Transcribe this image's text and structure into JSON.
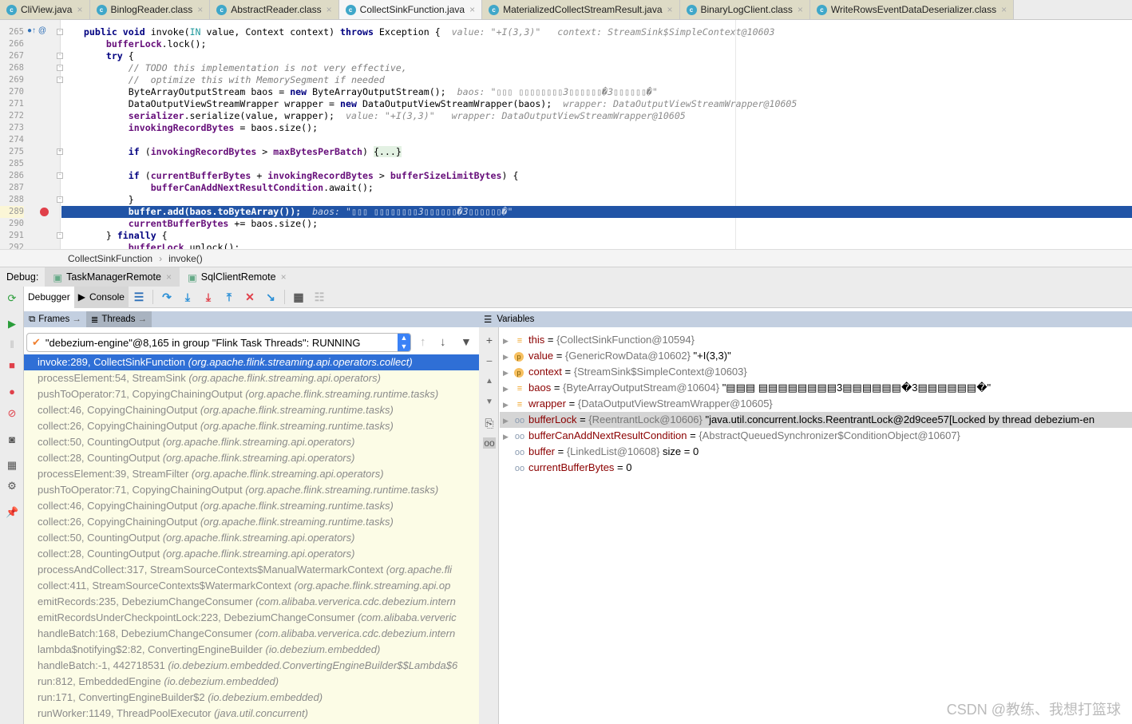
{
  "tabs": [
    {
      "label": "CliView.java",
      "active": false
    },
    {
      "label": "BinlogReader.class",
      "active": false
    },
    {
      "label": "AbstractReader.class",
      "active": false
    },
    {
      "label": "CollectSinkFunction.java",
      "active": true
    },
    {
      "label": "MaterializedCollectStreamResult.java",
      "active": false
    },
    {
      "label": "BinaryLogClient.class",
      "active": false
    },
    {
      "label": "WriteRowsEventDataDeserializer.class",
      "active": false
    }
  ],
  "editor": {
    "current_line": "289",
    "lines": [
      {
        "n": "265",
        "fold": "-",
        "segs": [
          [
            "    "
          ],
          [
            "public void ",
            "kw"
          ],
          [
            "invoke("
          ],
          [
            "IN",
            "ty"
          ],
          [
            " value, Context context) "
          ],
          [
            "throws",
            "kw"
          ],
          [
            " Exception {  "
          ],
          [
            "value: \"+I(3,3)\"   context: StreamSink$SimpleContext@10603",
            "hint"
          ]
        ]
      },
      {
        "n": "266",
        "segs": [
          [
            "        "
          ],
          [
            "bufferLock",
            "fld"
          ],
          [
            ".lock();"
          ]
        ]
      },
      {
        "n": "267",
        "fold": "-",
        "segs": [
          [
            "        "
          ],
          [
            "try",
            "kw"
          ],
          [
            " {"
          ]
        ]
      },
      {
        "n": "268",
        "fold": "-",
        "segs": [
          [
            "            "
          ],
          [
            "// TODO this implementation is not very effective,",
            "cm"
          ]
        ]
      },
      {
        "n": "269",
        "fold": "-",
        "segs": [
          [
            "            "
          ],
          [
            "//  optimize this with MemorySegment if needed",
            "cm"
          ]
        ]
      },
      {
        "n": "270",
        "segs": [
          [
            "            ByteArrayOutputStream baos = "
          ],
          [
            "new",
            "kw"
          ],
          [
            " ByteArrayOutputStream();  "
          ],
          [
            "baos: \"▯▯▯ ▯▯▯▯▯▯▯▯3▯▯▯▯▯▯�3▯▯▯▯▯▯�\"",
            "hint"
          ]
        ]
      },
      {
        "n": "271",
        "segs": [
          [
            "            DataOutputViewStreamWrapper wrapper = "
          ],
          [
            "new",
            "kw"
          ],
          [
            " DataOutputViewStreamWrapper(baos);  "
          ],
          [
            "wrapper: DataOutputViewStreamWrapper@10605",
            "hint"
          ]
        ]
      },
      {
        "n": "272",
        "segs": [
          [
            "            "
          ],
          [
            "serializer",
            "fld"
          ],
          [
            ".serialize(value, wrapper);  "
          ],
          [
            "value: \"+I(3,3)\"   wrapper: DataOutputViewStreamWrapper@10605",
            "hint"
          ]
        ]
      },
      {
        "n": "273",
        "segs": [
          [
            "            "
          ],
          [
            "invokingRecordBytes",
            "fld"
          ],
          [
            " = baos.size();"
          ]
        ]
      },
      {
        "n": "274",
        "segs": [
          [
            ""
          ]
        ]
      },
      {
        "n": "275",
        "fold": "+",
        "segs": [
          [
            "            "
          ],
          [
            "if",
            "kw"
          ],
          [
            " ("
          ],
          [
            "invokingRecordBytes",
            "fld"
          ],
          [
            " > "
          ],
          [
            "maxBytesPerBatch",
            "fld"
          ],
          [
            ") "
          ],
          [
            "{...}",
            "foldbox"
          ]
        ]
      },
      {
        "n": "285",
        "segs": [
          [
            ""
          ]
        ]
      },
      {
        "n": "286",
        "fold": "-",
        "segs": [
          [
            "            "
          ],
          [
            "if",
            "kw"
          ],
          [
            " ("
          ],
          [
            "currentBufferBytes",
            "fld"
          ],
          [
            " + "
          ],
          [
            "invokingRecordBytes",
            "fld"
          ],
          [
            " > "
          ],
          [
            "bufferSizeLimitBytes",
            "fld"
          ],
          [
            ") {"
          ]
        ]
      },
      {
        "n": "287",
        "segs": [
          [
            "                "
          ],
          [
            "bufferCanAddNextResultCondition",
            "fld"
          ],
          [
            ".await();"
          ]
        ]
      },
      {
        "n": "288",
        "fold": "-",
        "segs": [
          [
            "            }"
          ]
        ]
      },
      {
        "n": "289",
        "hl": true,
        "segs": [
          [
            "            "
          ],
          [
            "buffer",
            "fld"
          ],
          [
            ".add(baos.toByteArray());",
            "kw"
          ],
          [
            "  "
          ],
          [
            "baos: \"▯▯▯ ▯▯▯▯▯▯▯▯3▯▯▯▯▯▯�3▯▯▯▯▯▯�\"",
            "hint"
          ]
        ]
      },
      {
        "n": "290",
        "segs": [
          [
            "            "
          ],
          [
            "currentBufferBytes",
            "fld"
          ],
          [
            " += baos.size();"
          ]
        ]
      },
      {
        "n": "291",
        "fold": "-",
        "segs": [
          [
            "        } "
          ],
          [
            "finally",
            "kw"
          ],
          [
            " {"
          ]
        ]
      },
      {
        "n": "292",
        "segs": [
          [
            "            "
          ],
          [
            "bufferLock",
            "fld"
          ],
          [
            ".unlock();"
          ]
        ]
      }
    ]
  },
  "breadcrumb": {
    "class": "CollectSinkFunction",
    "method": "invoke()",
    "sep": "›"
  },
  "debug": {
    "label": "Debug:",
    "sessions": [
      {
        "label": "TaskManagerRemote",
        "active": true
      },
      {
        "label": "SqlClientRemote",
        "active": false
      }
    ]
  },
  "toolbar": {
    "debugger": "Debugger",
    "console": "Console"
  },
  "frames": {
    "tab_frames": "Frames",
    "tab_threads": "Threads",
    "thread": "\"debezium-engine\"@8,165 in group \"Flink Task Threads\": RUNNING",
    "items": [
      {
        "m": "invoke:289, CollectSinkFunction",
        "p": "(org.apache.flink.streaming.api.operators.collect)",
        "sel": true
      },
      {
        "m": "processElement:54, StreamSink",
        "p": "(org.apache.flink.streaming.api.operators)"
      },
      {
        "m": "pushToOperator:71, CopyingChainingOutput",
        "p": "(org.apache.flink.streaming.runtime.tasks)"
      },
      {
        "m": "collect:46, CopyingChainingOutput",
        "p": "(org.apache.flink.streaming.runtime.tasks)"
      },
      {
        "m": "collect:26, CopyingChainingOutput",
        "p": "(org.apache.flink.streaming.runtime.tasks)"
      },
      {
        "m": "collect:50, CountingOutput",
        "p": "(org.apache.flink.streaming.api.operators)"
      },
      {
        "m": "collect:28, CountingOutput",
        "p": "(org.apache.flink.streaming.api.operators)"
      },
      {
        "m": "processElement:39, StreamFilter",
        "p": "(org.apache.flink.streaming.api.operators)"
      },
      {
        "m": "pushToOperator:71, CopyingChainingOutput",
        "p": "(org.apache.flink.streaming.runtime.tasks)"
      },
      {
        "m": "collect:46, CopyingChainingOutput",
        "p": "(org.apache.flink.streaming.runtime.tasks)"
      },
      {
        "m": "collect:26, CopyingChainingOutput",
        "p": "(org.apache.flink.streaming.runtime.tasks)"
      },
      {
        "m": "collect:50, CountingOutput",
        "p": "(org.apache.flink.streaming.api.operators)"
      },
      {
        "m": "collect:28, CountingOutput",
        "p": "(org.apache.flink.streaming.api.operators)"
      },
      {
        "m": "processAndCollect:317, StreamSourceContexts$ManualWatermarkContext",
        "p": "(org.apache.fli"
      },
      {
        "m": "collect:411, StreamSourceContexts$WatermarkContext",
        "p": "(org.apache.flink.streaming.api.op"
      },
      {
        "m": "emitRecords:235, DebeziumChangeConsumer",
        "p": "(com.alibaba.ververica.cdc.debezium.intern"
      },
      {
        "m": "emitRecordsUnderCheckpointLock:223, DebeziumChangeConsumer",
        "p": "(com.alibaba.ververic"
      },
      {
        "m": "handleBatch:168, DebeziumChangeConsumer",
        "p": "(com.alibaba.ververica.cdc.debezium.intern"
      },
      {
        "m": "lambda$notifying$2:82, ConvertingEngineBuilder",
        "p": "(io.debezium.embedded)"
      },
      {
        "m": "handleBatch:-1, 442718531",
        "p": "(io.debezium.embedded.ConvertingEngineBuilder$$Lambda$6"
      },
      {
        "m": "run:812, EmbeddedEngine",
        "p": "(io.debezium.embedded)"
      },
      {
        "m": "run:171, ConvertingEngineBuilder$2",
        "p": "(io.debezium.embedded)"
      },
      {
        "m": "runWorker:1149, ThreadPoolExecutor",
        "p": "(java.util.concurrent)"
      }
    ]
  },
  "variables": {
    "title": "Variables",
    "items": [
      {
        "icon": "field",
        "expand": true,
        "name": "this",
        "type": "{CollectSinkFunction@10594}",
        "val": ""
      },
      {
        "icon": "param",
        "expand": true,
        "name": "value",
        "type": "{GenericRowData@10602}",
        "val": "\"+I(3,3)\""
      },
      {
        "icon": "param",
        "expand": true,
        "name": "context",
        "type": "{StreamSink$SimpleContext@10603}",
        "val": ""
      },
      {
        "icon": "field",
        "expand": true,
        "name": "baos",
        "type": "{ByteArrayOutputStream@10604}",
        "val": "\"▤▤▤ ▤▤▤▤▤▤▤▤3▤▤▤▤▤▤�3▤▤▤▤▤▤�\""
      },
      {
        "icon": "field",
        "expand": true,
        "name": "wrapper",
        "type": "{DataOutputViewStreamWrapper@10605}",
        "val": ""
      },
      {
        "icon": "watch",
        "expand": true,
        "sel": true,
        "name": "bufferLock",
        "type": "{ReentrantLock@10606}",
        "val": "\"java.util.concurrent.locks.ReentrantLock@2d9cee57[Locked by thread debezium-en"
      },
      {
        "icon": "watch",
        "expand": true,
        "name": "bufferCanAddNextResultCondition",
        "type": "{AbstractQueuedSynchronizer$ConditionObject@10607}",
        "val": ""
      },
      {
        "icon": "watch",
        "expand": false,
        "name": "buffer",
        "type": "{LinkedList@10608}",
        "val": " size = 0"
      },
      {
        "icon": "watch",
        "expand": false,
        "name": "currentBufferBytes",
        "type": "",
        "val": "0"
      }
    ]
  },
  "watermark": "CSDN @教练、我想打篮球",
  "colors": {
    "selection": "#2f6fd6",
    "current_line": "#2154a6",
    "frames_bg": "#fcfce6",
    "header": "#c3cfe0"
  }
}
